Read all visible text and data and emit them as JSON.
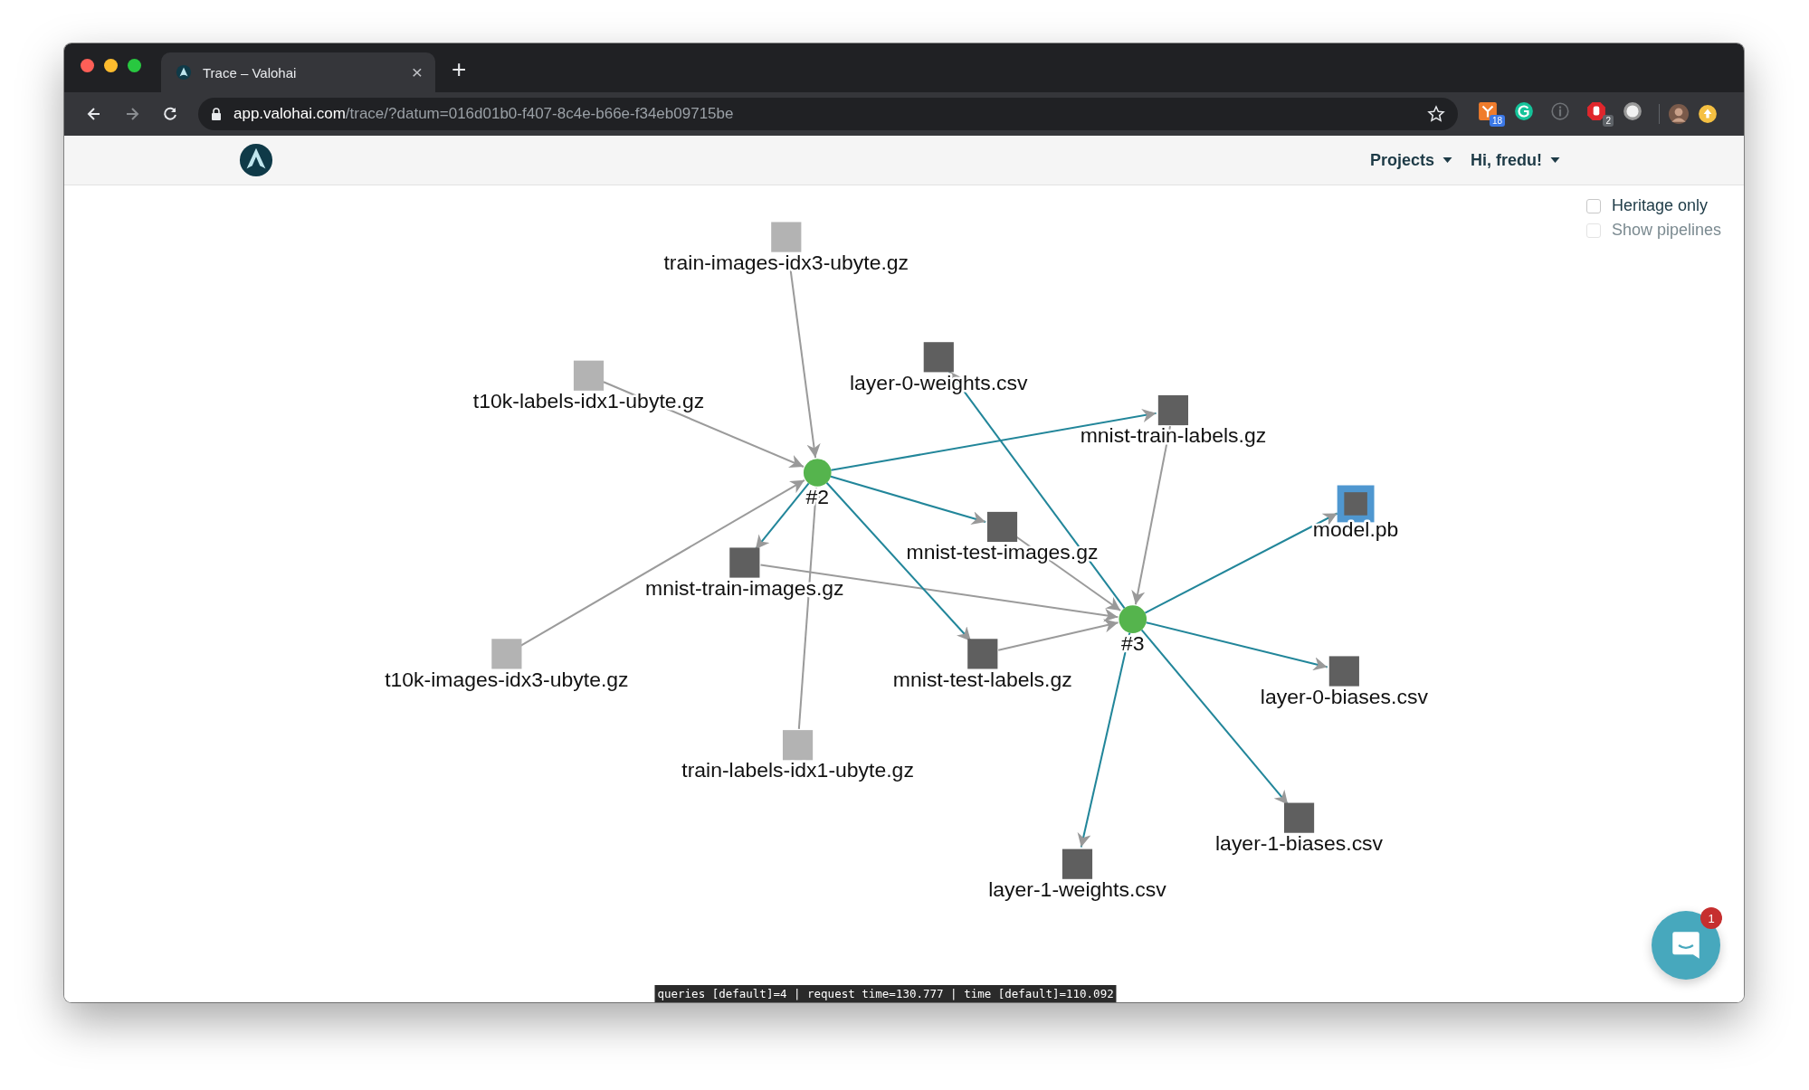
{
  "browser": {
    "tab": {
      "title": "Trace – Valohai",
      "close": "×"
    },
    "new_tab": "+",
    "url": {
      "host": "app.valohai.com",
      "path": "/trace/?datum=016d01b0-f407-8c4e-b66e-f34eb09715be"
    },
    "extensions": [
      {
        "kind": "network",
        "badge": "18"
      },
      {
        "kind": "grammar"
      },
      {
        "kind": "info"
      },
      {
        "kind": "blocker",
        "badge": "2"
      },
      {
        "kind": "orb"
      }
    ]
  },
  "header": {
    "menus": [
      {
        "label": "Projects"
      },
      {
        "label": "Hi, fredu!"
      }
    ]
  },
  "options": [
    {
      "label": "Heritage only",
      "checked": false,
      "disabled": false
    },
    {
      "label": "Show pipelines",
      "checked": false,
      "disabled": true
    }
  ],
  "graph": {
    "nodes": [
      {
        "kind": "datum",
        "name": "train-images-idx3-ubyte.gz",
        "dimmed": true,
        "selected": false
      },
      {
        "kind": "datum",
        "name": "t10k-labels-idx1-ubyte.gz",
        "dimmed": true,
        "selected": false
      },
      {
        "kind": "datum",
        "name": "layer-0-weights.csv",
        "dimmed": false,
        "selected": false
      },
      {
        "kind": "datum",
        "name": "mnist-train-labels.gz",
        "dimmed": false,
        "selected": false
      },
      {
        "kind": "execution",
        "name": "#2"
      },
      {
        "kind": "datum",
        "name": "model.pb",
        "dimmed": false,
        "selected": true
      },
      {
        "kind": "datum",
        "name": "mnist-test-images.gz",
        "dimmed": false,
        "selected": false
      },
      {
        "kind": "datum",
        "name": "mnist-train-images.gz",
        "dimmed": false,
        "selected": false
      },
      {
        "kind": "execution",
        "name": "#3"
      },
      {
        "kind": "datum",
        "name": "t10k-images-idx3-ubyte.gz",
        "dimmed": true,
        "selected": false
      },
      {
        "kind": "datum",
        "name": "mnist-test-labels.gz",
        "dimmed": false,
        "selected": false
      },
      {
        "kind": "datum",
        "name": "layer-0-biases.csv",
        "dimmed": false,
        "selected": false
      },
      {
        "kind": "datum",
        "name": "train-labels-idx1-ubyte.gz",
        "dimmed": true,
        "selected": false
      },
      {
        "kind": "datum",
        "name": "layer-1-biases.csv",
        "dimmed": false,
        "selected": false
      },
      {
        "kind": "datum",
        "name": "layer-1-weights.csv",
        "dimmed": false,
        "selected": false
      }
    ]
  },
  "debug_bar": "queries [default]=4 | request time=130.777 | time [default]=110.092",
  "chat": {
    "badge": "1"
  }
}
